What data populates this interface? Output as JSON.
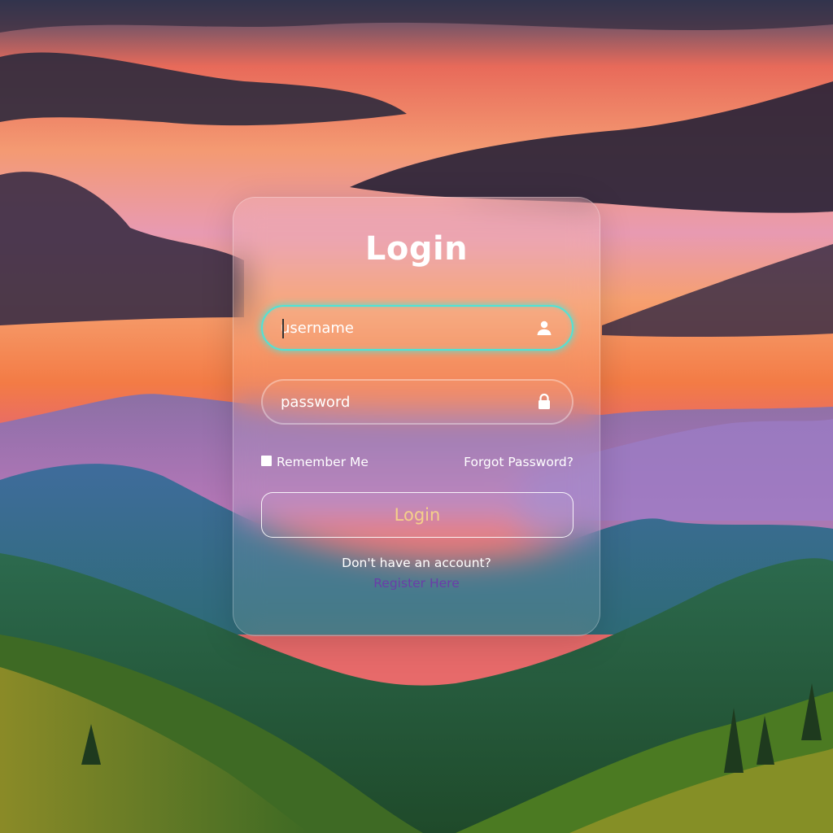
{
  "colors": {
    "focus_ring": "#4fe3d6",
    "button_text": "#f5d08a",
    "link": "#6a3ea8",
    "text": "#ffffff"
  },
  "login_form": {
    "title": "Login",
    "username": {
      "placeholder": "username",
      "value": "",
      "icon": "user-icon",
      "focused": true
    },
    "password": {
      "placeholder": "password",
      "value": "",
      "icon": "lock-icon"
    },
    "remember_me": {
      "label": "Remember Me",
      "checked": false
    },
    "forgot_password": "Forgot Password?",
    "submit_label": "Login",
    "no_account_text": "Don't have an account?",
    "register_link": "Register Here"
  }
}
